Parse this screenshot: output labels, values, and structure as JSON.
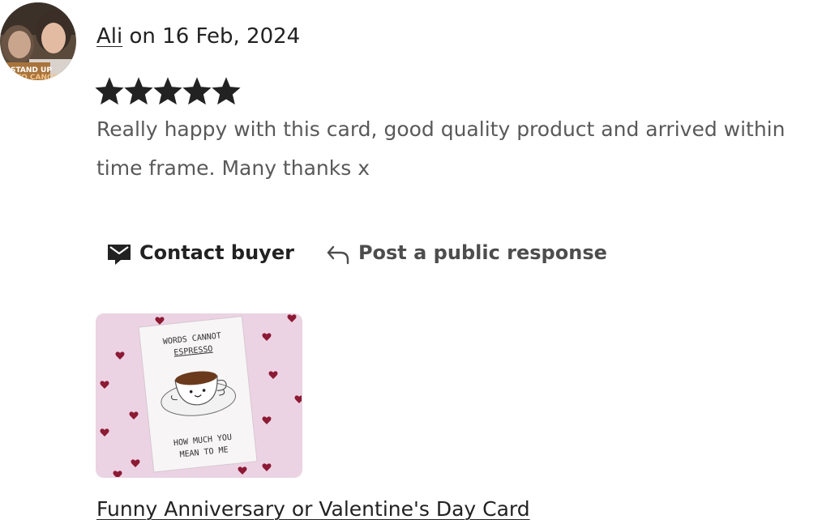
{
  "review": {
    "reviewer_name": "Ali",
    "date_text": " on 16 Feb, 2024",
    "rating": 5,
    "rating_max": 5,
    "text_line1": "Really happy with this card, good quality product and arrived within",
    "text_line2": "time frame. Many thanks x"
  },
  "avatar": {
    "badge_line1": "STAND UP",
    "badge_line2": "TO CANCER"
  },
  "actions": {
    "contact_label": "Contact buyer",
    "contact_icon": "envelope-message-icon",
    "respond_label": "Post a public response",
    "respond_icon": "reply-arrow-icon"
  },
  "product": {
    "listing_title": "Funny Anniversary or Valentine's Day Card",
    "card_top_line1": "WORDS CANNOT",
    "card_top_line2": "ESPRESSO",
    "card_bottom_line1": "HOW MUCH YOU",
    "card_bottom_line2": "MEAN TO ME"
  },
  "colors": {
    "star": "#222222",
    "text_secondary": "#595959",
    "thumb_background": "#ecd3e3",
    "heart": "#8c1a35"
  }
}
